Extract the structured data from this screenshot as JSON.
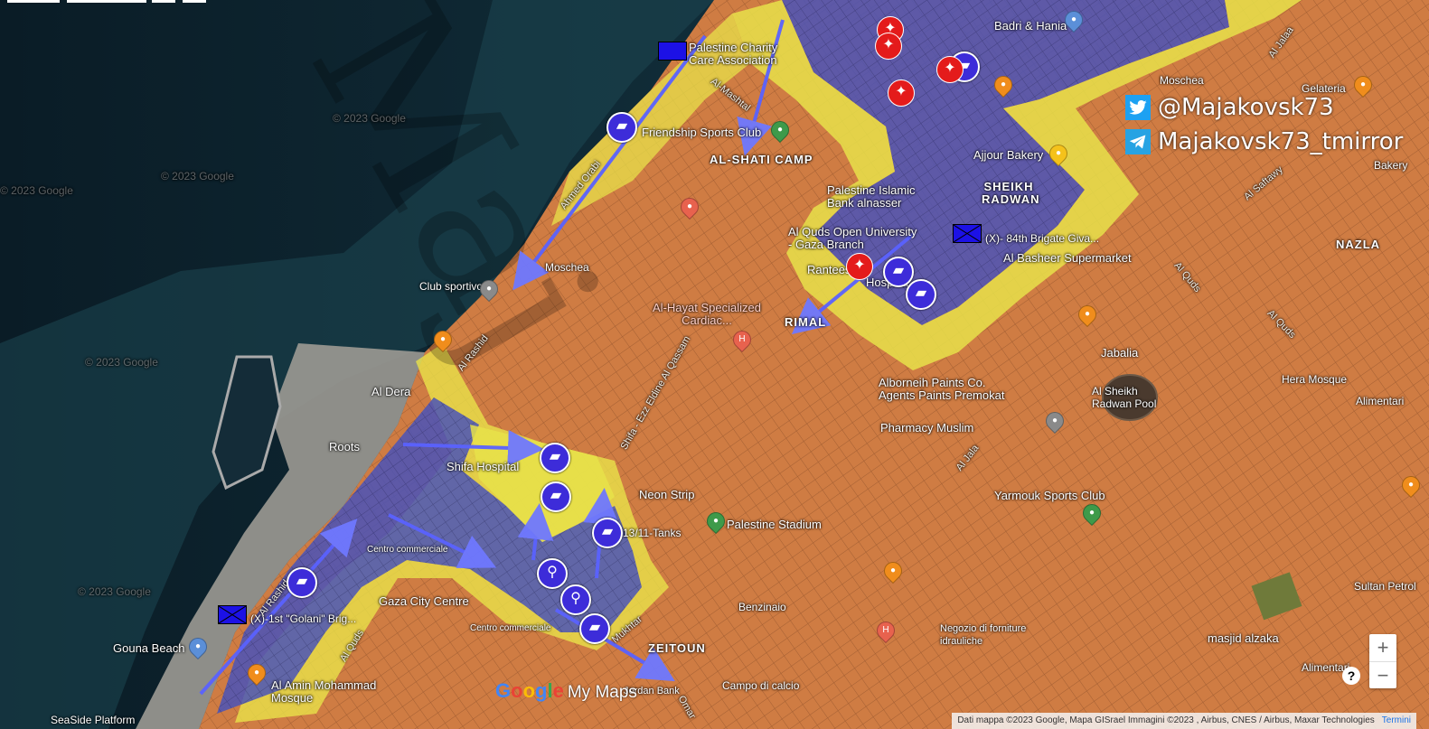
{
  "social": {
    "twitter": "@Majakovsk73",
    "telegram": "Majakovsk73_tmirror"
  },
  "map_logo": {
    "google": "Google",
    "suffix": "My Maps"
  },
  "attribution": {
    "text": "Dati mappa ©2023 Google, Mapa GISrael Immagini ©2023 , Airbus, CNES / Airbus, Maxar Technologies",
    "terms": "Termini"
  },
  "zoom": {
    "plus": "+",
    "minus": "−"
  },
  "help": "?",
  "colors": {
    "controlled_zone": "#e38b47",
    "contested_zone": "#e8e24a",
    "idf_zone": "#4a54b8",
    "idf_marker": "#3d2cd9",
    "hostile_marker": "#e41b1b",
    "sea": "#0e2a38"
  },
  "copyright_tiles": [
    "© 2023 Google",
    "© 2023 Google",
    "© 2023 Google",
    "© 2023 Google",
    "© 2023 Google"
  ],
  "districts": {
    "al_shati": "AL-SHATI CAMP",
    "sheikh_radwan": "SHEIKH RADWAN",
    "nazla": "NAZLA",
    "rimal": "RIMAL",
    "zeitoun": "ZEITOUN",
    "jabalia": "Jabalia"
  },
  "places": {
    "palestine_charity": "Palestine Charity Care Association",
    "friendship": "Friendship Sports Club",
    "badri": "Badri & Hania",
    "moschea1": "Moschea",
    "gelateria": "Gelateria",
    "bakery": "Bakery",
    "ajjour": "Ajjour Bakery",
    "pib": "Palestine Islamic Bank alnasser",
    "alquds": "Al Quds Open University - Gaza Branch",
    "ranteesi": "Ranteesi",
    "hospital": "Hospital",
    "brigade84": "(X)- 84th Brigate Giva...",
    "al_basheer": "Al Basheer Supermarket",
    "club_sportivo": "Club sportivo",
    "moschea2": "Moschea",
    "al_hayat": "Al-Hayat Specialized Cardiac...",
    "al_dera": "Al Dera",
    "alborneih": "Alborneih Paints Co. Agents Paints Premokat",
    "pharmacy": "Pharmacy Muslim",
    "sheikh_pool": "Al Sheikh Radwan Pool",
    "hera": "Hera Mosque",
    "alimentari1": "Alimentari",
    "roots": "Roots",
    "shifa": "Shifa Hospital",
    "neon_strip": "Neon Strip",
    "tanks": "13/11-Tanks",
    "palestine_stadium": "Palestine Stadium",
    "yarmouk": "Yarmouk Sports Club",
    "centro1": "Centro commerciale",
    "gaza_city_centre": "Gaza City Centre",
    "centro2": "Centro commerciale",
    "golani": "(X)-1st \"Golani\" Brig...",
    "gouna": "Gouna Beach",
    "al_amin": "Al Amin Mohammad Mosque",
    "seaside": "SeaSide Platform",
    "benzinaio": "Benzinaio",
    "negozio": "Negozio di forniture idrauliche",
    "campo": "Campo di calcio",
    "sultan": "Sultan Petrol",
    "masjid": "masjid alzaka",
    "alimentari2": "Alimentari",
    "jordan": "Jordan Bank"
  },
  "roads": {
    "ahmed_orabi": "Ahmed Orabi",
    "al_mashtal": "Al-Mashtal",
    "al_rashid1": "Al Rashid",
    "al_rashid2": "Al Rashid",
    "ezz": "Shifa - Ezz Eldine Al Qassam",
    "al_quds1": "Al Quds",
    "al_quds2": "Al Quds",
    "al_quds3": "Al Quds",
    "al_jala": "Al Jala",
    "al_saftawy": "Al Saftawy",
    "omar": "Omar",
    "mukhtar": "Mukhtar",
    "al_jala_top": "Al Jalaa"
  },
  "watermark": "Maj"
}
